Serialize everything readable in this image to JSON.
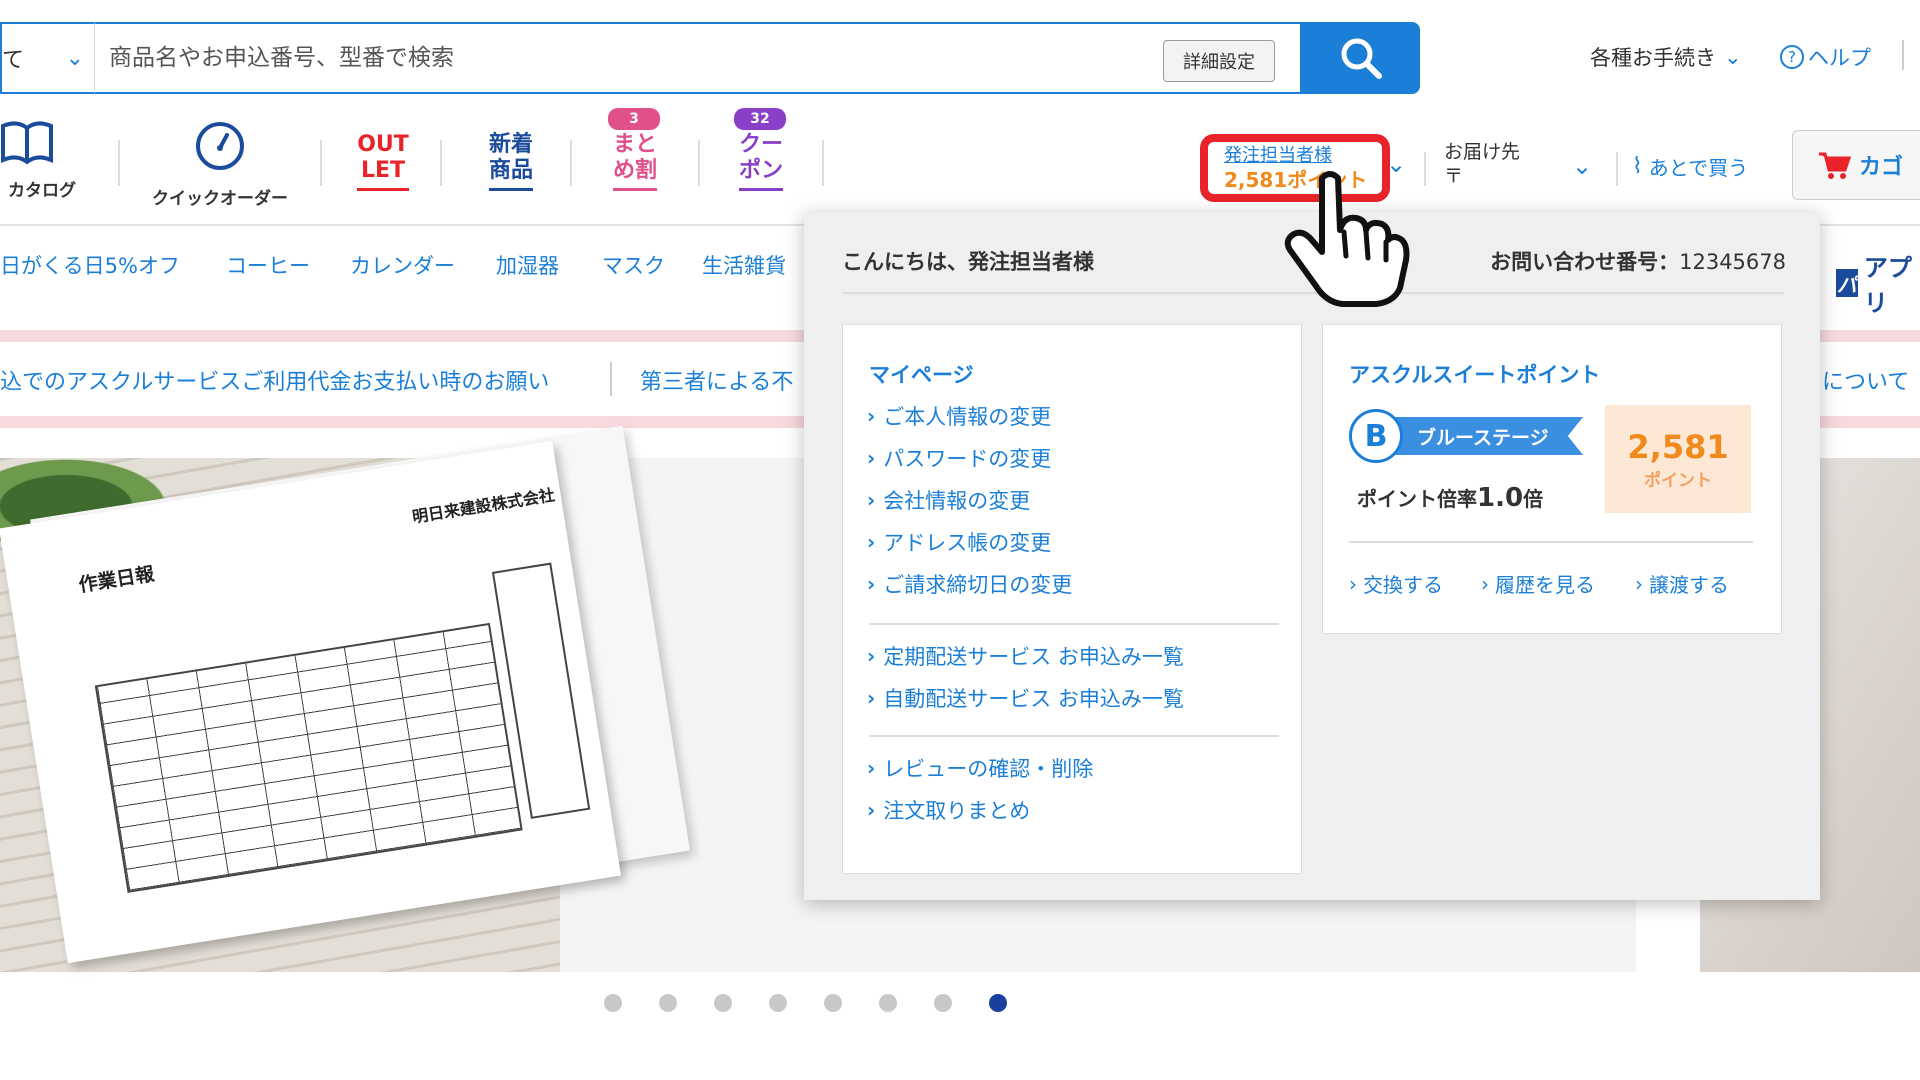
{
  "header": {
    "category_label": "て",
    "search_placeholder": "商品名やお申込番号、型番で検索",
    "advanced_label": "詳細設定",
    "procedures_label": "各種お手続き",
    "help_label": "ヘルプ"
  },
  "nav": {
    "catalog_label": "カタログ",
    "quick_order_label": "クイックオーダー",
    "outlet_line1": "OUT",
    "outlet_line2": "LET",
    "new_line1": "新着",
    "new_line2": "商品",
    "bulk_badge": "3",
    "bulk_line1": "まと",
    "bulk_line2": "め割",
    "coupon_badge": "32",
    "coupon_line1": "クー",
    "coupon_line2": "ポン",
    "user_name": "発注担当者様",
    "user_points": "2,581ポイント",
    "delivery_line1": "お届け先",
    "delivery_line2": "〒",
    "later_label": "あとで買う",
    "cart_label": "カゴ"
  },
  "categories": [
    "日がくる日5%オフ",
    "コーヒー",
    "カレンダー",
    "加湿器",
    "マスク",
    "生活雑貨"
  ],
  "app_label": "アプリ",
  "notices": {
    "notice_1": "込でのアスクルサービスご利用代金お支払い時のお願い",
    "notice_2": "第三者による不",
    "notice_3": "について"
  },
  "banner": {
    "form_title": "作業日報",
    "form_company": "明日来建設株式会社"
  },
  "carousel": {
    "count": 8,
    "active": 8
  },
  "dropdown": {
    "greeting": "こんにちは、発注担当者様",
    "inquiry_label": "お問い合わせ番号：",
    "inquiry_number": "12345678",
    "mypage": {
      "title": "マイページ",
      "links": [
        "ご本人情報の変更",
        "パスワードの変更",
        "会社情報の変更",
        "アドレス帳の変更",
        "ご請求締切日の変更",
        "定期配送サービス お申込み一覧",
        "自動配送サービス お申込み一覧",
        "レビューの確認・削除",
        "注文取りまとめ"
      ]
    },
    "points": {
      "title": "アスクルスイートポイント",
      "stage_letter": "B",
      "stage_label": "ブルーステージ",
      "rate_label": "ポイント倍率",
      "rate_value": "1.0",
      "rate_suffix": "倍",
      "value": "2,581",
      "unit": "ポイント",
      "links": [
        "交換する",
        "履歴を見る",
        "譲渡する"
      ]
    }
  },
  "colors": {
    "accent": "#1b7fd8",
    "highlight_red": "#e8242a",
    "points_orange": "#f08a1c",
    "outlet_red": "#e8242a",
    "new_blue": "#1b4b9b",
    "bulk_pink": "#e0508a",
    "coupon_purple": "#8a3fc8"
  }
}
